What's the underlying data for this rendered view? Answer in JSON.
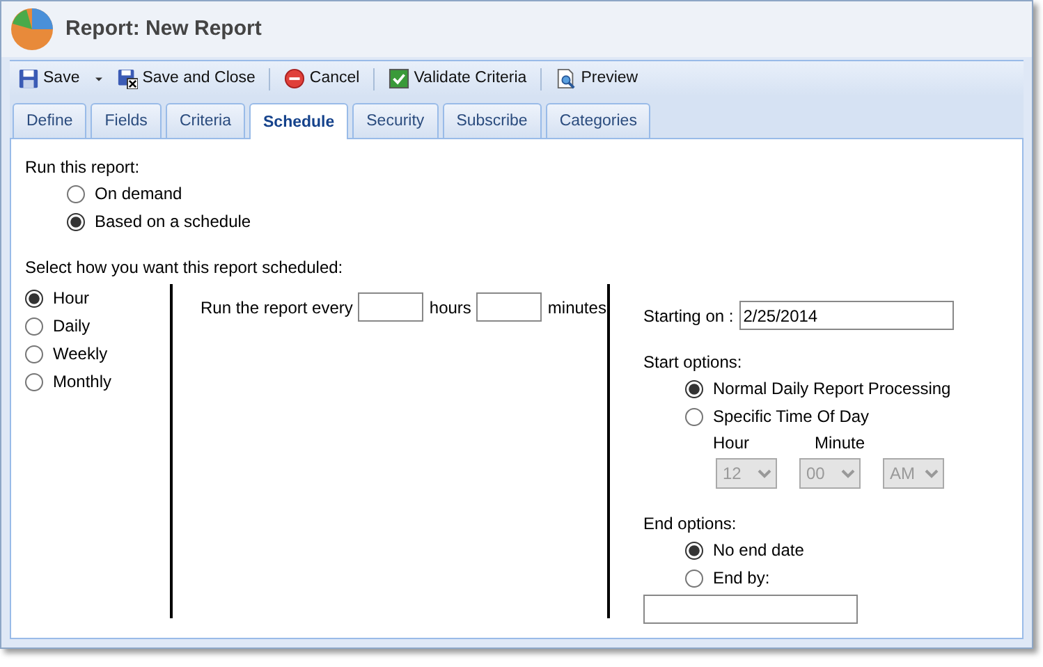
{
  "window": {
    "title": "Report: New Report"
  },
  "toolbar": [
    {
      "label": "Save",
      "kind": "save",
      "menu": true
    },
    {
      "label": "Save and Close",
      "kind": "save-close",
      "menu": false
    },
    {
      "label": "Cancel",
      "kind": "cancel",
      "menu": false
    },
    {
      "label": "Validate Criteria",
      "kind": "validate",
      "menu": false
    },
    {
      "label": "Preview",
      "kind": "preview",
      "menu": false
    }
  ],
  "tabs": [
    {
      "label": "Define",
      "selected": false
    },
    {
      "label": "Fields",
      "selected": false
    },
    {
      "label": "Criteria",
      "selected": false
    },
    {
      "label": "Schedule",
      "selected": true
    },
    {
      "label": "Security",
      "selected": false
    },
    {
      "label": "Subscribe",
      "selected": false
    },
    {
      "label": "Categories",
      "selected": false
    }
  ],
  "run_this_report": {
    "label": "Run this report:",
    "options": [
      {
        "label": "On demand",
        "selected": false
      },
      {
        "label": "Based on a schedule",
        "selected": true
      }
    ]
  },
  "schedule": {
    "label": "Select how you want this report scheduled:",
    "frequencies": [
      {
        "label": "Hour",
        "selected": true
      },
      {
        "label": "Daily",
        "selected": false
      },
      {
        "label": "Weekly",
        "selected": false
      },
      {
        "label": "Monthly",
        "selected": false
      }
    ],
    "run_every": {
      "prefix": "Run the report every",
      "hours_label": "hours",
      "minutes_label": "minutes"
    }
  },
  "starting_on": {
    "label": "Starting on :",
    "value": "2/25/2014"
  },
  "start_options": {
    "label": "Start options:",
    "options": [
      {
        "label": "Normal Daily Report Processing",
        "selected": true
      },
      {
        "label": "Specific Time Of Day",
        "selected": false
      }
    ],
    "hour_label": "Hour",
    "minute_label": "Minute",
    "selects": [
      {
        "value": "12",
        "disabled": true
      },
      {
        "value": "00",
        "disabled": true
      },
      {
        "value": "AM",
        "disabled": true
      }
    ]
  },
  "end_options": {
    "label": "End options:",
    "options": [
      {
        "label": "No end date",
        "selected": true
      },
      {
        "label": "End by:",
        "selected": false
      }
    ]
  }
}
